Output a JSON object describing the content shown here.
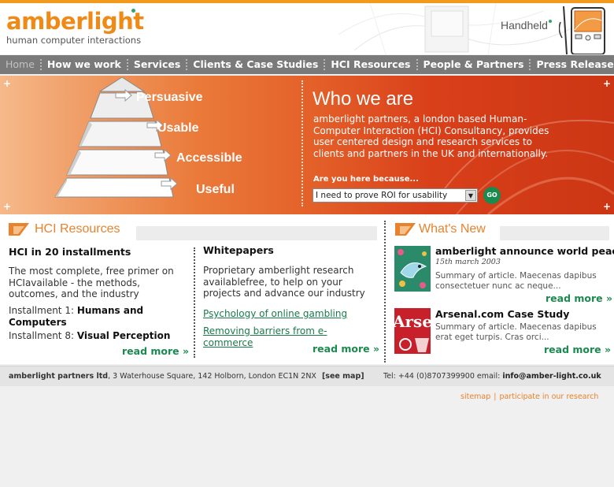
{
  "brand": {
    "name": "amberlight",
    "tagline": "human computer interactions",
    "header_link": "Handheld"
  },
  "colors": {
    "accent": "#f08a17",
    "nav_bg": "#7a7a7a",
    "link": "#1a7a4a",
    "banner_start": "#f6b98a",
    "banner_end": "#cc3614"
  },
  "nav": {
    "items": [
      {
        "label": "Home",
        "active": true
      },
      {
        "label": "How we work"
      },
      {
        "label": "Services"
      },
      {
        "label": "Clients & Case Studies"
      },
      {
        "label": "HCI Resources"
      },
      {
        "label": "People & Partners"
      },
      {
        "label": "Press Releases"
      }
    ]
  },
  "banner": {
    "pyramid_levels": [
      "Persuasive",
      "Usable",
      "Accessible",
      "Useful"
    ],
    "who_title": "Who we are",
    "who_body": "amberlight partners, a london based Human-Computer Interaction (HCI) Consultancy, provides user centered design and research services to clients and partners in the UK and internationally.",
    "question": "Are you here because...",
    "select_value": "I need to prove ROI for usability",
    "go_label": "GO"
  },
  "hci": {
    "section_title": "HCI Resources",
    "left": {
      "heading": "HCI in 20 installments",
      "intro": "The most complete, free primer on HCIavailable - the methods, outcomes, and the industry",
      "install1_prefix": "Installment 1: ",
      "install1_title": "Humans and Computers",
      "install8_prefix": "Installment 8: ",
      "install8_title": "Visual Perception",
      "more": "read more »"
    },
    "right": {
      "heading": "Whitepapers",
      "intro": "Proprietary amberlight research availablefree, to help on your projects and advance our industry",
      "link1": "Psychology of online gambling",
      "link2": "Removing barriers from e-commerce",
      "more": "read more »"
    }
  },
  "news": {
    "section_title": "What's New",
    "items": [
      {
        "title": "amberlight announce world peace",
        "date": "15th march 2003",
        "summary": "Summary of article. Maecenas dapibus consectetuer nunc ac neque...",
        "more": "read more »",
        "thumb_icon": "bird-illustration-icon"
      },
      {
        "title": "Arsenal.com Case Study",
        "date": "",
        "summary": "Summary of article. Maecenas dapibus erat eget turpis. Cras orci...",
        "more": "read more »",
        "thumb_text": "Arse",
        "thumb_icon": "arsenal-logo-icon"
      }
    ]
  },
  "footer": {
    "company": "amberlight partners ltd",
    "address": ", 3 Waterhouse Square, 142 Holborn,  London EC1N 2NX",
    "map_link": "[see map]",
    "tel": "Tel: +44 (0)8707399900 email: ",
    "email": "info@amber-light.co.uk",
    "links": [
      "sitemap",
      "participate in our research"
    ]
  }
}
